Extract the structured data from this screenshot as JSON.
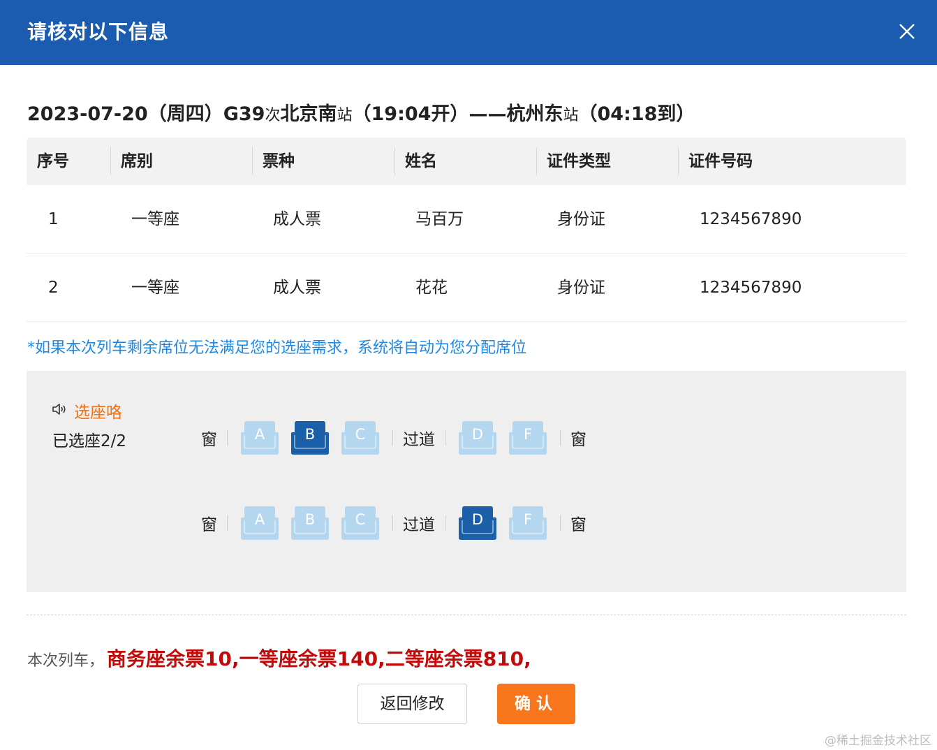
{
  "dialog": {
    "title": "请核对以下信息"
  },
  "trip": {
    "date": "2023-07-20",
    "weekday": "（周四）",
    "train": "G39",
    "train_suffix": "次",
    "from": "北京南",
    "from_suffix": "站",
    "depart": "（19:04开）",
    "dash": "——",
    "to": "杭州东",
    "to_suffix": "站",
    "arrive": "（04:18到）"
  },
  "table": {
    "headers": [
      "序号",
      "席别",
      "票种",
      "姓名",
      "证件类型",
      "证件号码"
    ],
    "rows": [
      [
        "1",
        "一等座",
        "成人票",
        "马百万",
        "身份证",
        "1234567890"
      ],
      [
        "2",
        "一等座",
        "成人票",
        "花花",
        "身份证",
        "1234567890"
      ]
    ]
  },
  "notice": "*如果本次列车剩余席位无法满足您的选座需求，系统将自动为您分配席位",
  "seat_selection": {
    "title": "选座咯",
    "count_label": "已选座2/2",
    "window_label": "窗",
    "aisle_label": "过道",
    "rows": [
      {
        "left": [
          {
            "letter": "A",
            "selected": false
          },
          {
            "letter": "B",
            "selected": true
          },
          {
            "letter": "C",
            "selected": false
          }
        ],
        "right": [
          {
            "letter": "D",
            "selected": false
          },
          {
            "letter": "F",
            "selected": false
          }
        ]
      },
      {
        "left": [
          {
            "letter": "A",
            "selected": false
          },
          {
            "letter": "B",
            "selected": false
          },
          {
            "letter": "C",
            "selected": false
          }
        ],
        "right": [
          {
            "letter": "D",
            "selected": true
          },
          {
            "letter": "F",
            "selected": false
          }
        ]
      }
    ],
    "colors": {
      "selected": "#1a5fa8",
      "unselected": "#b5d6ef"
    }
  },
  "remaining": {
    "label": "本次列车，",
    "value": "商务座余票10,一等座余票140,二等座余票810,"
  },
  "buttons": {
    "back": "返回修改",
    "confirm": "确认"
  },
  "watermark": "@稀土掘金技术社区"
}
